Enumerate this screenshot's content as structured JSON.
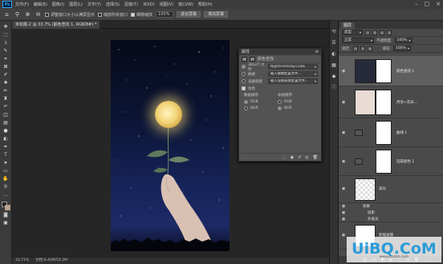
{
  "menubar": {
    "logo": "Ps",
    "items": [
      "文件(F)",
      "编辑(E)",
      "图像(I)",
      "图层(L)",
      "文字(Y)",
      "选择(S)",
      "滤镜(T)",
      "3D(D)",
      "视图(V)",
      "窗口(W)",
      "帮助(H)"
    ]
  },
  "options": {
    "cb_resize": "调整窗口大小以满屏显示",
    "cb_all_windows": "缩放所有窗口",
    "cb_scrubby": "细微缩放",
    "zoom_value": "100%",
    "btn_fit": "适合屏幕",
    "btn_fill": "填充屏幕"
  },
  "document": {
    "tab_label": "未标题-2 @ 33.7% (颜色查找 1, RGB/8#) *",
    "status_zoom": "33.71%",
    "status_doc": "文档:8.44M/54.2M"
  },
  "properties": {
    "title": "属性",
    "subtitle": "颜色查找",
    "row1_label": "3DLUT 文件",
    "row1_value": "NightFromDay.CUBE",
    "row2_label": "摘要",
    "row2_value": "载入摘要配置文件...",
    "row3_label": "设备链接",
    "row3_value": "载入设备链接配置文件...",
    "dither_label": "仿色",
    "data_order_label": "数据顺序",
    "table_order_label": "表格顺序",
    "opt_rgb": "RGB",
    "opt_bgr": "BGR"
  },
  "layers": {
    "tab_label": "图层",
    "kind_label": "类型",
    "blend_mode": "正常",
    "opacity_label": "不透明度:",
    "opacity_value": "100%",
    "lock_label": "锁定:",
    "fill_label": "填充:",
    "fill_value": "100%",
    "items": [
      {
        "name": "颜色查找 1"
      },
      {
        "name": "月亮+花朵..."
      },
      {
        "name": "曲线 1"
      },
      {
        "name": "选取颜色 1"
      },
      {
        "name": "高光"
      },
      {
        "name": "效果"
      },
      {
        "name": "投影"
      },
      {
        "name": "外发光"
      },
      {
        "name": "智能滤镜"
      }
    ]
  },
  "watermark": {
    "brand": "UiBQ.CoM",
    "url": "www.psahz.com"
  },
  "colors": {
    "accent": "#31a8ff",
    "panel_bg": "#535353",
    "canvas_bg": "#262626"
  }
}
